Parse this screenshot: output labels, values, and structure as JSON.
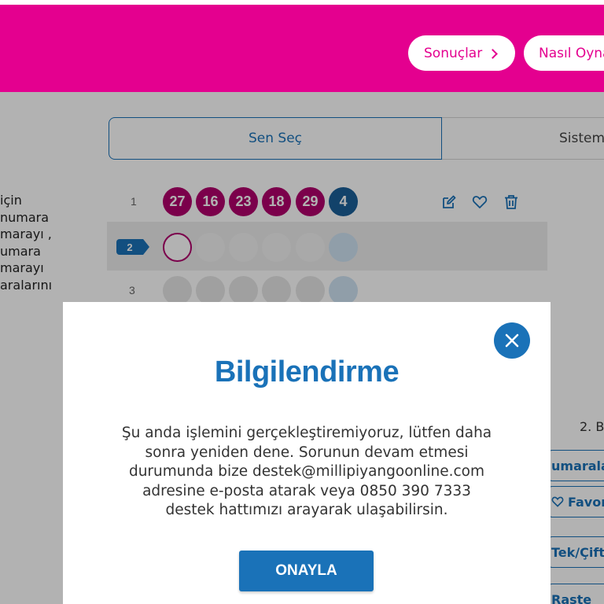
{
  "header": {
    "results_label": "Sonuçlar",
    "how_to_play_label": "Nasıl Oynanır"
  },
  "tabs": [
    {
      "label": "Sen Seç",
      "active": true
    },
    {
      "label": "Sistem",
      "active": false
    }
  ],
  "help_text": {
    "lines": [
      "için",
      "numara",
      "marayı ,",
      "umara",
      "marayı",
      "aralarını"
    ]
  },
  "rows": [
    {
      "number": "1",
      "main_numbers": [
        "27",
        "16",
        "23",
        "18",
        "29"
      ],
      "bonus_number": "4"
    },
    {
      "number": "2",
      "main_numbers": [],
      "bonus_number": ""
    },
    {
      "number": "3",
      "main_numbers": [],
      "bonus_number": ""
    }
  ],
  "row_actions": {
    "edit_icon": "edit-icon",
    "favorite_icon": "heart-icon",
    "delete_icon": "trash-icon"
  },
  "right_panel": {
    "label_2b": "2. B",
    "btn_numbers": "umarala",
    "btn_favorites": "Favor",
    "btn_oddeven": "Tek/Çift",
    "btn_random": "Raste"
  },
  "modal": {
    "title": "Bilgilendirme",
    "message_lines": [
      "Şu anda işlemini gerçekleştiremiyoruz, lütfen daha",
      "sonra yeniden dene. Sorunun devam etmesi",
      "durumunda bize destek@millipiyangoonline.com",
      "adresine e-posta atarak veya 0850 390 7333",
      "destek hattımızı arayarak ulaşabilirsin."
    ],
    "confirm_label": "ONAYLA",
    "close_icon": "close-icon"
  },
  "colors": {
    "brand_pink": "#e4008f",
    "ball_pink": "#b0006c",
    "accent_blue": "#1a72b8"
  }
}
